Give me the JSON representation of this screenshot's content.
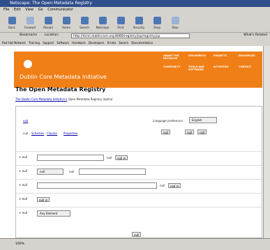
{
  "window": {
    "title": "Netscape: The Open Metadata Registry"
  },
  "menu": [
    "File",
    "Edit",
    "View",
    "Go",
    "Communicator"
  ],
  "toolbar": [
    {
      "label": "Back"
    },
    {
      "label": "Forward"
    },
    {
      "label": "Reload"
    },
    {
      "label": "Home"
    },
    {
      "label": "Search"
    },
    {
      "label": "Netscape"
    },
    {
      "label": "Print"
    },
    {
      "label": "Security"
    },
    {
      "label": "Shop"
    },
    {
      "label": "Stop"
    }
  ],
  "location": {
    "bookmarks_label": "Bookmarks",
    "location_label": "Location:",
    "url": "http://dcmi.dublincore.org:8080/registry/jsp/registry.jsp",
    "related_label": "What's Related"
  },
  "personal_toolbar": [
    "Red Hat Network",
    "Training",
    "Support",
    "Software",
    "Hardware",
    "Developers",
    "Errata",
    "Search",
    "Documentation"
  ],
  "site": {
    "name": "Dublin Core Metadata Initiative",
    "nav": [
      "ABOUT THE INITIATIVE",
      "DOCUMENTS",
      "PROJECTS",
      "RESOURCES",
      "COMMUNITY",
      "TOOLS AND SOFTWARE",
      "ACTIVITIES",
      "CONTACT"
    ]
  },
  "page": {
    "title": "The Open Metadata Registry",
    "subtitle_link": "The Dublin Core Metadata Initiative's",
    "subtitle_rest": "Open Metadata Registry (alpha)"
  },
  "panel": {
    "top_link": "null",
    "language_label": "Language preference",
    "language_value": "English",
    "tabs": [
      "null",
      "Schemes",
      "Classes",
      "Properties"
    ],
    "mini_btns": [
      "null",
      "null",
      "null"
    ],
    "rows": [
      {
        "plus": "+ null",
        "after": "null"
      },
      {
        "plus": "+ null",
        "sel": "null",
        "mid": "null"
      },
      {
        "plus": "+ null",
        "after": "null"
      },
      {
        "plus": "+ null"
      },
      {
        "plus": "+ null",
        "sel": "Any Element"
      }
    ],
    "submit": "null"
  },
  "status": {
    "percent": "100%"
  }
}
